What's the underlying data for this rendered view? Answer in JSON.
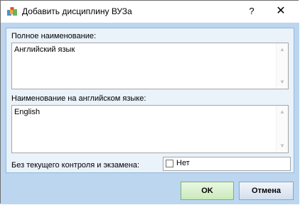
{
  "window": {
    "title": "Добавить дисциплину ВУЗа",
    "help_label": "?",
    "close_label": "✕",
    "icon": "app-icon"
  },
  "form": {
    "full_name_label": "Полное наименование:",
    "full_name_value": "Английский язык",
    "english_name_label": "Наименование на английском языке:",
    "english_name_value": "English",
    "no_control_label": "Без текущего контроля и экзамена:",
    "no_control_checked": false,
    "no_control_value": "Нет"
  },
  "buttons": {
    "ok_label": "OK",
    "cancel_label": "Отмена"
  },
  "colors": {
    "client_bg": "#bcd6ef",
    "panel_bg": "#eaf2fa",
    "ok_accent": "#c9eab9"
  }
}
